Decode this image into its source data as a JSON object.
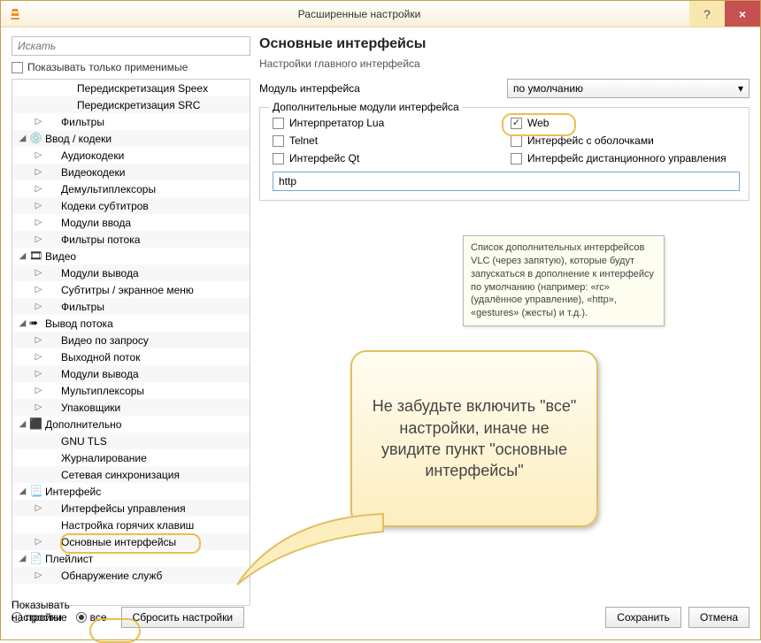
{
  "titlebar": {
    "title": "Расширенные настройки",
    "help": "?",
    "close": "×"
  },
  "left": {
    "search_placeholder": "Искать",
    "show_applicable": "Показывать только применимые",
    "tree": [
      {
        "indent": 2,
        "label": "Передискретизация Speex"
      },
      {
        "indent": 2,
        "label": "Передискретизация SRC"
      },
      {
        "indent": 1,
        "tw": "▷",
        "label": "Фильтры"
      },
      {
        "indent": 0,
        "tw": "◢",
        "icon": "cd",
        "label": "Ввод / кодеки"
      },
      {
        "indent": 1,
        "tw": "▷",
        "label": "Аудиокодеки"
      },
      {
        "indent": 1,
        "tw": "▷",
        "label": "Видеокодеки"
      },
      {
        "indent": 1,
        "tw": "▷",
        "label": "Демультиплексоры"
      },
      {
        "indent": 1,
        "tw": "▷",
        "label": "Кодеки субтитров"
      },
      {
        "indent": 1,
        "tw": "▷",
        "label": "Модули ввода"
      },
      {
        "indent": 1,
        "tw": "▷",
        "label": "Фильтры потока"
      },
      {
        "indent": 0,
        "tw": "◢",
        "icon": "vid",
        "label": "Видео"
      },
      {
        "indent": 1,
        "tw": "▷",
        "label": "Модули вывода"
      },
      {
        "indent": 1,
        "tw": "▷",
        "label": "Субтитры / экранное меню"
      },
      {
        "indent": 1,
        "tw": "▷",
        "label": "Фильтры"
      },
      {
        "indent": 0,
        "tw": "◢",
        "icon": "out",
        "label": "Вывод потока"
      },
      {
        "indent": 1,
        "tw": "▷",
        "label": "Видео по запросу"
      },
      {
        "indent": 1,
        "tw": "▷",
        "label": "Выходной поток"
      },
      {
        "indent": 1,
        "tw": "▷",
        "label": "Модули вывода"
      },
      {
        "indent": 1,
        "tw": "▷",
        "label": "Мультиплексоры"
      },
      {
        "indent": 1,
        "tw": "▷",
        "label": "Упаковщики"
      },
      {
        "indent": 0,
        "tw": "◢",
        "icon": "adv",
        "label": "Дополнительно"
      },
      {
        "indent": 1,
        "label": "GNU TLS"
      },
      {
        "indent": 1,
        "label": "Журналирование"
      },
      {
        "indent": 1,
        "label": "Сетевая синхронизация"
      },
      {
        "indent": 0,
        "tw": "◢",
        "icon": "iface",
        "label": "Интерфейс"
      },
      {
        "indent": 1,
        "tw": "▷",
        "label": "Интерфейсы управления"
      },
      {
        "indent": 1,
        "label": "Настройка горячих клавиш"
      },
      {
        "indent": 1,
        "tw": "▷",
        "label": "Основные интерфейсы",
        "hl": true
      },
      {
        "indent": 0,
        "tw": "◢",
        "icon": "pl",
        "label": "Плейлист"
      },
      {
        "indent": 1,
        "tw": "▷",
        "label": "Обнаружение служб"
      }
    ]
  },
  "right": {
    "heading": "Основные интерфейсы",
    "sub": "Настройки главного интерфейса",
    "module_label": "Модуль интерфейса",
    "module_value": "по умолчанию",
    "group_legend": "Дополнительные модули интерфейса",
    "cb": {
      "lua": "Интерпретатор Lua",
      "web": "Web",
      "telnet": "Telnet",
      "skins": "Интерфейс с оболочками",
      "qt": "Интерфейс Qt",
      "remote": "Интерфейс дистанционного управления"
    },
    "input_value": "http"
  },
  "tooltip": "Список дополнительных интерфейсов VLC (через запятую), которые будут запускаться в дополнение к интерфейсу по умолчанию (например: «rc» (удалённое управление), «http», «gestures» (жесты) и т.д.).",
  "callout": "Не забудьте включить \"все\" настройки, иначе не увидите пункт \"основные интерфейсы\"",
  "footer": {
    "show_label": "Показывать настройки",
    "simple": "простые",
    "all": "все",
    "reset": "Сбросить настройки",
    "save": "Сохранить",
    "cancel": "Отмена"
  }
}
